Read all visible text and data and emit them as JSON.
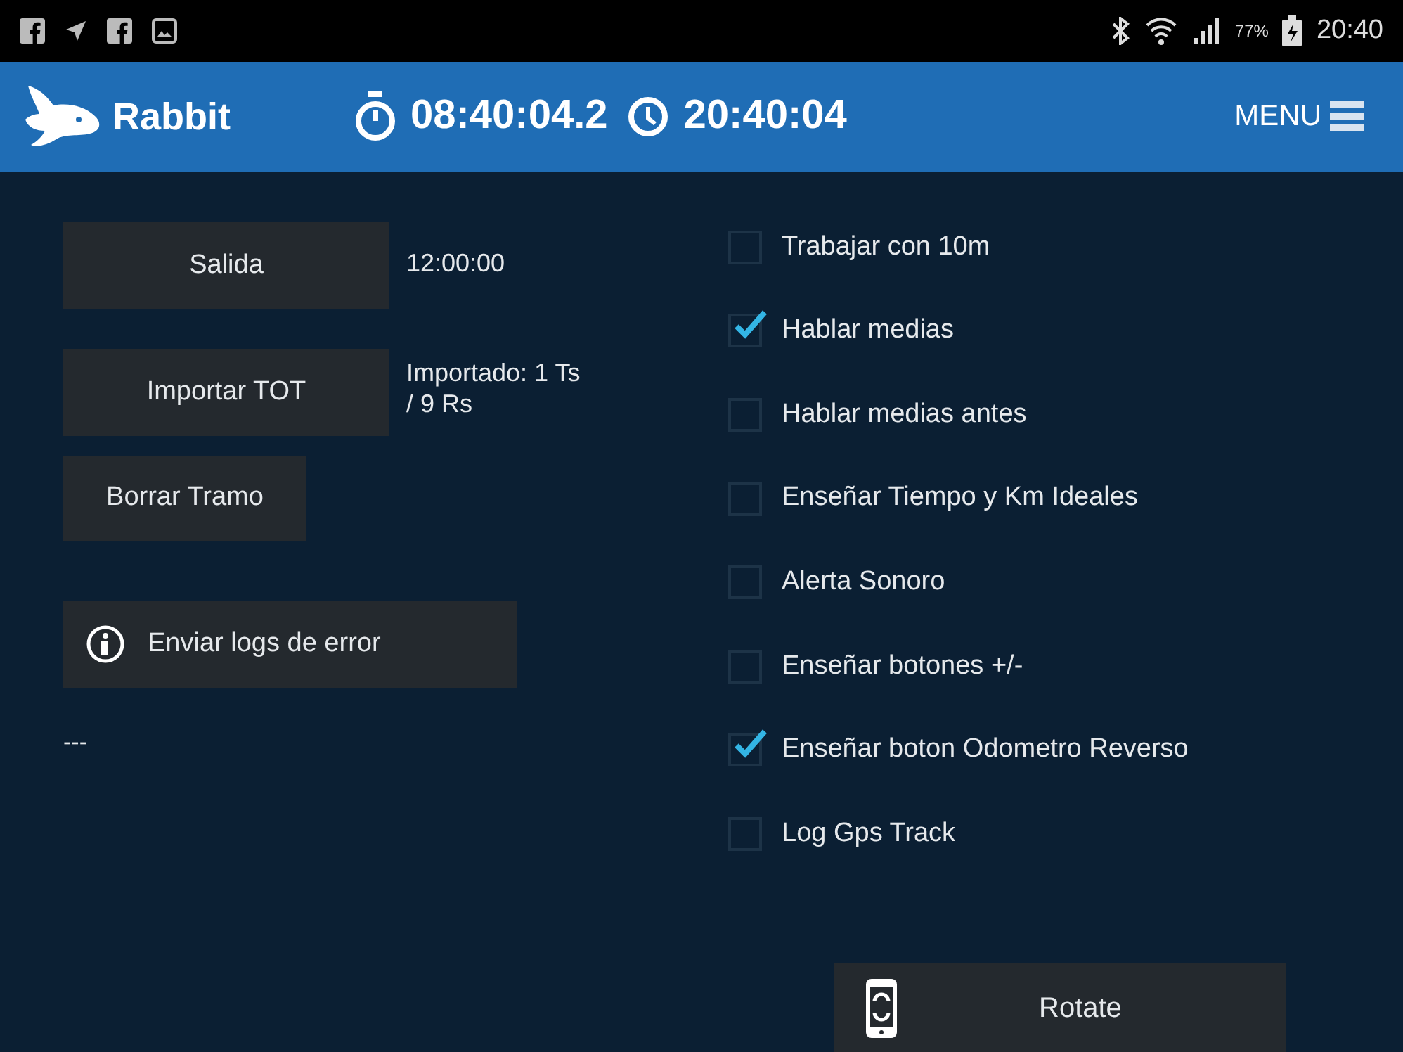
{
  "status_bar": {
    "battery_percent": "77%",
    "time": "20:40"
  },
  "header": {
    "app_name": "Rabbit",
    "stopwatch": "08:40:04.2",
    "clock": "20:40:04",
    "menu": "MENU"
  },
  "left_panel": {
    "rows": [
      {
        "kind": "button",
        "label": "Salida",
        "info": "12:00:00"
      },
      {
        "kind": "button",
        "label": "Importar TOT",
        "info": "Importado: 1 Ts\n / 9 Rs"
      },
      {
        "kind": "small_button",
        "label": "Borrar Tramo"
      },
      {
        "kind": "icon_button",
        "label": "Enviar logs de error"
      }
    ],
    "log_text": "---"
  },
  "options": [
    {
      "label": "Trabajar con 10m",
      "checked": false
    },
    {
      "label": "Hablar medias",
      "checked": true
    },
    {
      "label": "Hablar medias antes",
      "checked": false
    },
    {
      "label": "Enseñar Tiempo y Km Ideales",
      "checked": false
    },
    {
      "label": "Alerta Sonoro",
      "checked": false
    },
    {
      "label": "Enseñar botones +/-",
      "checked": false
    },
    {
      "label": "Enseñar boton Odometro Reverso",
      "checked": true
    },
    {
      "label": "Log Gps Track",
      "checked": false
    }
  ],
  "rotate_button": {
    "label": "Rotate"
  }
}
